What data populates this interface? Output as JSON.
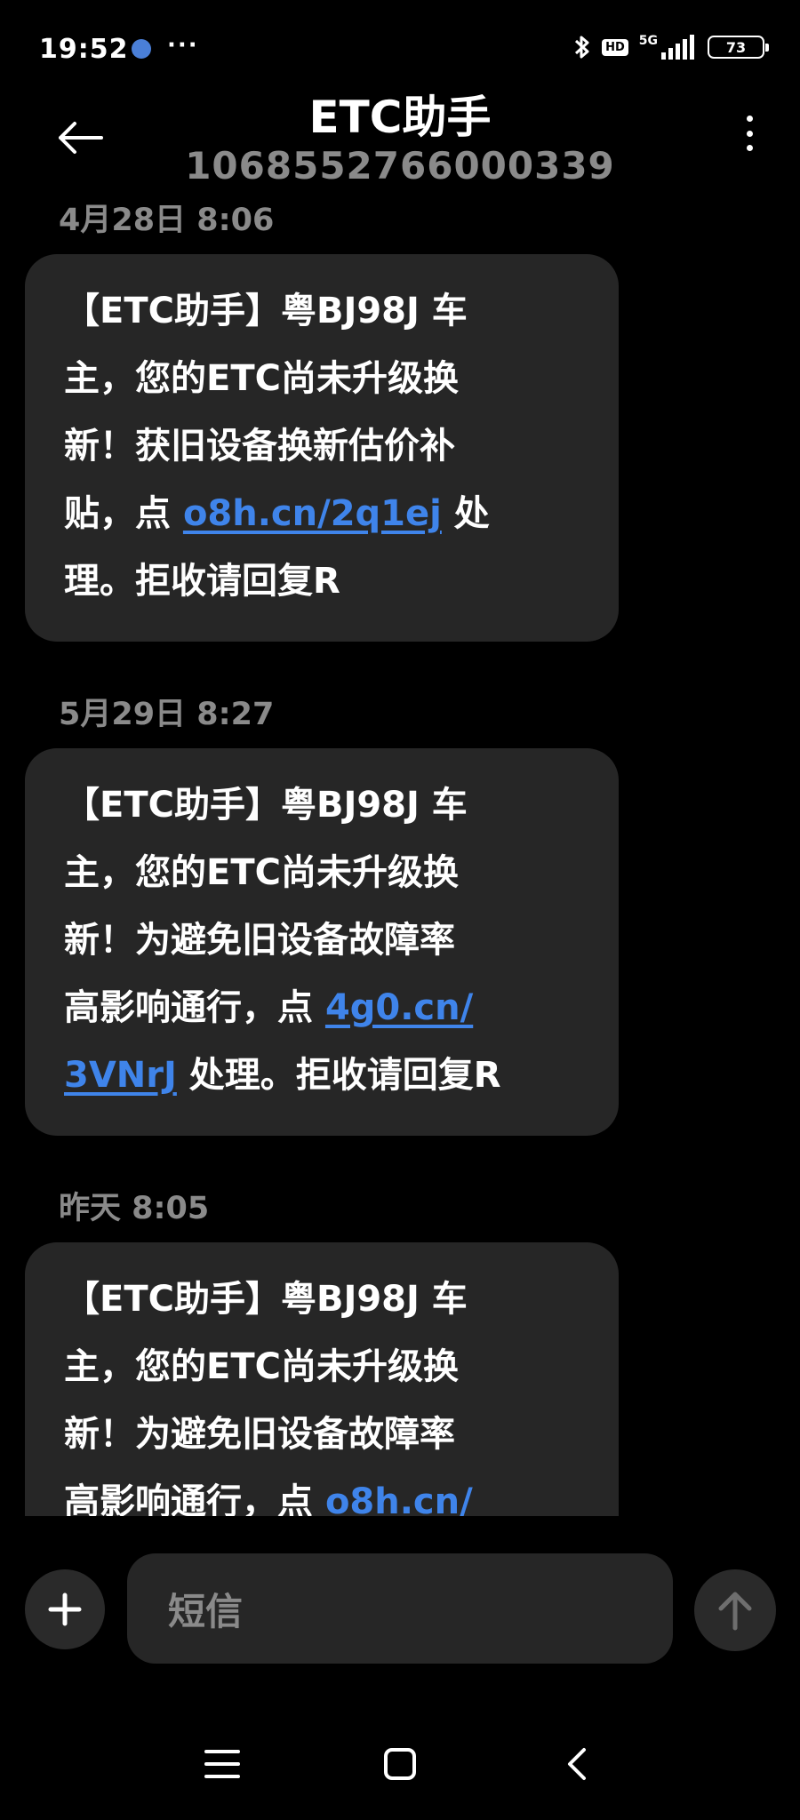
{
  "status_bar": {
    "time": "19:52",
    "more": "···",
    "hd": "HD",
    "network": "5G",
    "battery": "73"
  },
  "header": {
    "title": "ETC助手",
    "number": "1068552766000339"
  },
  "messages": [
    {
      "timestamp": "4月28日 8:06",
      "lines": [
        "【ETC助手】粤BJ98J 车",
        "主，您的ETC尚未升级换",
        "新！获旧设备换新估价补"
      ],
      "l4_pre": "贴，点 ",
      "link": "o8h.cn/2q1ej",
      "l4_post": " 处",
      "l5": "理。拒收请回复R"
    },
    {
      "timestamp": "5月29日 8:27",
      "lines": [
        "【ETC助手】粤BJ98J 车",
        "主，您的ETC尚未升级换",
        "新！为避免旧设备故障率"
      ],
      "l4_pre": "高影响通行，点 ",
      "link_a": "4g0.cn/",
      "link_b": "3VNrJ",
      "l5_post": " 处理。拒收请回复R"
    },
    {
      "timestamp": "昨天 8:05",
      "lines": [
        "【ETC助手】粤BJ98J 车",
        "主，您的ETC尚未升级换",
        "新！为避免旧设备故障率"
      ],
      "l4_pre": "高影响通行，点 ",
      "link": "o8h.cn/"
    }
  ],
  "input": {
    "placeholder": "短信"
  },
  "colors": {
    "background": "#000000",
    "bubble": "#262626",
    "link": "#3f84ea",
    "muted": "#8a8a8a"
  }
}
